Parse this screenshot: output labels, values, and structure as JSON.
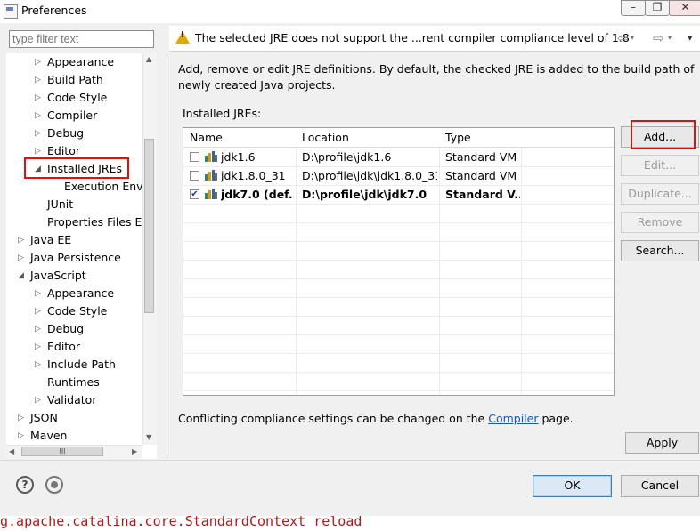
{
  "window": {
    "title": "Preferences",
    "controls": [
      "–",
      "❐",
      "✕"
    ]
  },
  "filter": {
    "placeholder": "type filter text"
  },
  "tree": {
    "items": [
      {
        "label": "Appearance",
        "indent": 2,
        "arrow": "▷"
      },
      {
        "label": "Build Path",
        "indent": 2,
        "arrow": "▷"
      },
      {
        "label": "Code Style",
        "indent": 2,
        "arrow": "▷"
      },
      {
        "label": "Compiler",
        "indent": 2,
        "arrow": "▷"
      },
      {
        "label": "Debug",
        "indent": 2,
        "arrow": "▷"
      },
      {
        "label": "Editor",
        "indent": 2,
        "arrow": "▷"
      },
      {
        "label": "Installed JREs",
        "indent": 2,
        "arrow": "◢",
        "highlighted": true
      },
      {
        "label": "Execution Envir",
        "indent": 3,
        "arrow": ""
      },
      {
        "label": "JUnit",
        "indent": 2,
        "arrow": ""
      },
      {
        "label": "Properties Files Ec",
        "indent": 2,
        "arrow": ""
      },
      {
        "label": "Java EE",
        "indent": 1,
        "arrow": "▷"
      },
      {
        "label": "Java Persistence",
        "indent": 1,
        "arrow": "▷"
      },
      {
        "label": "JavaScript",
        "indent": 1,
        "arrow": "◢"
      },
      {
        "label": "Appearance",
        "indent": 2,
        "arrow": "▷"
      },
      {
        "label": "Code Style",
        "indent": 2,
        "arrow": "▷"
      },
      {
        "label": "Debug",
        "indent": 2,
        "arrow": "▷"
      },
      {
        "label": "Editor",
        "indent": 2,
        "arrow": "▷"
      },
      {
        "label": "Include Path",
        "indent": 2,
        "arrow": "▷"
      },
      {
        "label": "Runtimes",
        "indent": 2,
        "arrow": ""
      },
      {
        "label": "Validator",
        "indent": 2,
        "arrow": "▷"
      },
      {
        "label": "JSON",
        "indent": 1,
        "arrow": "▷"
      },
      {
        "label": "Maven",
        "indent": 1,
        "arrow": "▷"
      }
    ],
    "hscroll_grip": "III"
  },
  "warning": {
    "text": "The selected JRE does not support the ...rent compiler compliance level of 1.8"
  },
  "nav": {
    "back": "⇦",
    "forward": "⇨",
    "menu": "▾"
  },
  "main": {
    "description": "Add, remove or edit JRE definitions. By default, the checked JRE is added to the build path of newly created Java projects.",
    "installed_label": "Installed JREs:",
    "columns": [
      "Name",
      "Location",
      "Type"
    ],
    "rows": [
      {
        "checked": false,
        "name": "jdk1.6",
        "location": "D:\\profile\\jdk1.6",
        "type": "Standard VM",
        "bold": false
      },
      {
        "checked": false,
        "name": "jdk1.8.0_31",
        "location": "D:\\profile\\jdk\\jdk1.8.0_31",
        "type": "Standard VM",
        "bold": false
      },
      {
        "checked": true,
        "name": "jdk7.0 (def...",
        "location": "D:\\profile\\jdk\\jdk7.0",
        "type": "Standard V...",
        "bold": true
      }
    ],
    "buttons": {
      "add": "Add...",
      "edit": "Edit...",
      "duplicate": "Duplicate...",
      "remove": "Remove",
      "search": "Search..."
    },
    "conflict_prefix": "Conflicting compliance settings can be changed on the ",
    "conflict_link": "Compiler",
    "conflict_suffix": " page.",
    "apply": "Apply"
  },
  "footer": {
    "help": "?",
    "ok": "OK",
    "cancel": "Cancel"
  },
  "console": {
    "text": "g.apache.catalina.core.StandardContext reload"
  },
  "colors": {
    "highlight": "#e01010",
    "link": "#1a57b8",
    "console": "#b01919"
  }
}
